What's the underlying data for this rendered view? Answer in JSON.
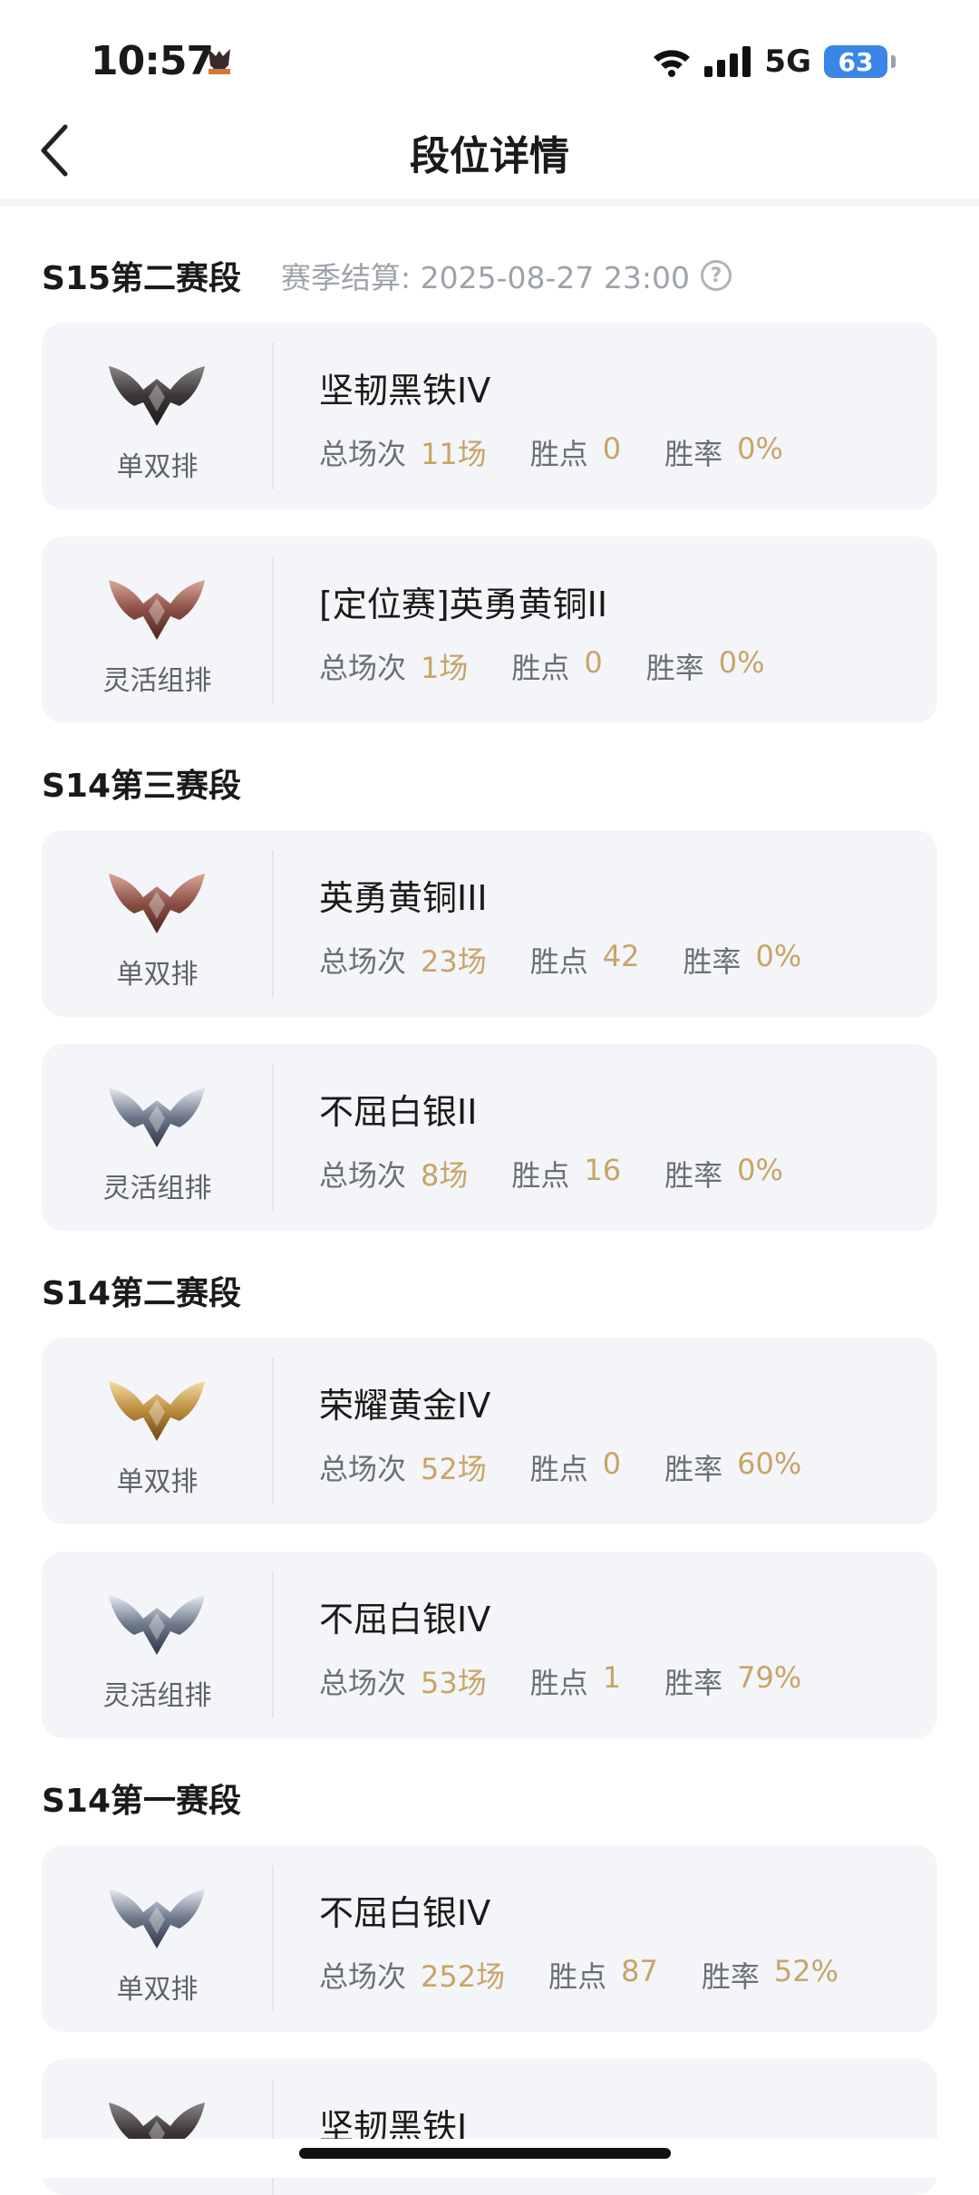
{
  "status_bar": {
    "time": "10:57",
    "network": "5G",
    "battery": "63"
  },
  "nav": {
    "title": "段位详情"
  },
  "colors": {
    "card_bg": "#f4f5f8",
    "accent_value": "#c8a467",
    "battery": "#3a86e8"
  },
  "sections": [
    {
      "title": "S15第二赛段",
      "settle_text": "赛季结算: 2025-08-27 23:00",
      "help_icon": "?",
      "cards": [
        {
          "emblem": "iron-emblem-icon",
          "queue": "单双排",
          "rank": "坚韧黑铁IV",
          "games_label": "总场次",
          "games": "11场",
          "lp_label": "胜点",
          "lp": "0",
          "wr_label": "胜率",
          "wr": "0%"
        },
        {
          "emblem": "bronze-emblem-icon",
          "queue": "灵活组排",
          "rank": "[定位赛]英勇黄铜II",
          "games_label": "总场次",
          "games": "1场",
          "lp_label": "胜点",
          "lp": "0",
          "wr_label": "胜率",
          "wr": "0%"
        }
      ]
    },
    {
      "title": "S14第三赛段",
      "cards": [
        {
          "emblem": "bronze-emblem-icon",
          "queue": "单双排",
          "rank": "英勇黄铜III",
          "games_label": "总场次",
          "games": "23场",
          "lp_label": "胜点",
          "lp": "42",
          "wr_label": "胜率",
          "wr": "0%"
        },
        {
          "emblem": "silver-emblem-icon",
          "queue": "灵活组排",
          "rank": "不屈白银II",
          "games_label": "总场次",
          "games": "8场",
          "lp_label": "胜点",
          "lp": "16",
          "wr_label": "胜率",
          "wr": "0%"
        }
      ]
    },
    {
      "title": "S14第二赛段",
      "cards": [
        {
          "emblem": "gold-emblem-icon",
          "queue": "单双排",
          "rank": "荣耀黄金IV",
          "games_label": "总场次",
          "games": "52场",
          "lp_label": "胜点",
          "lp": "0",
          "wr_label": "胜率",
          "wr": "60%"
        },
        {
          "emblem": "silver-emblem-icon",
          "queue": "灵活组排",
          "rank": "不屈白银IV",
          "games_label": "总场次",
          "games": "53场",
          "lp_label": "胜点",
          "lp": "1",
          "wr_label": "胜率",
          "wr": "79%"
        }
      ]
    },
    {
      "title": "S14第一赛段",
      "cards": [
        {
          "emblem": "silver-emblem-icon",
          "queue": "单双排",
          "rank": "不屈白银IV",
          "games_label": "总场次",
          "games": "252场",
          "lp_label": "胜点",
          "lp": "87",
          "wr_label": "胜率",
          "wr": "52%"
        },
        {
          "emblem": "iron-emblem-icon",
          "queue": "",
          "rank": "坚韧黑铁I",
          "games_label": "",
          "games": "",
          "lp_label": "",
          "lp": "",
          "wr_label": "",
          "wr": ""
        }
      ]
    }
  ]
}
